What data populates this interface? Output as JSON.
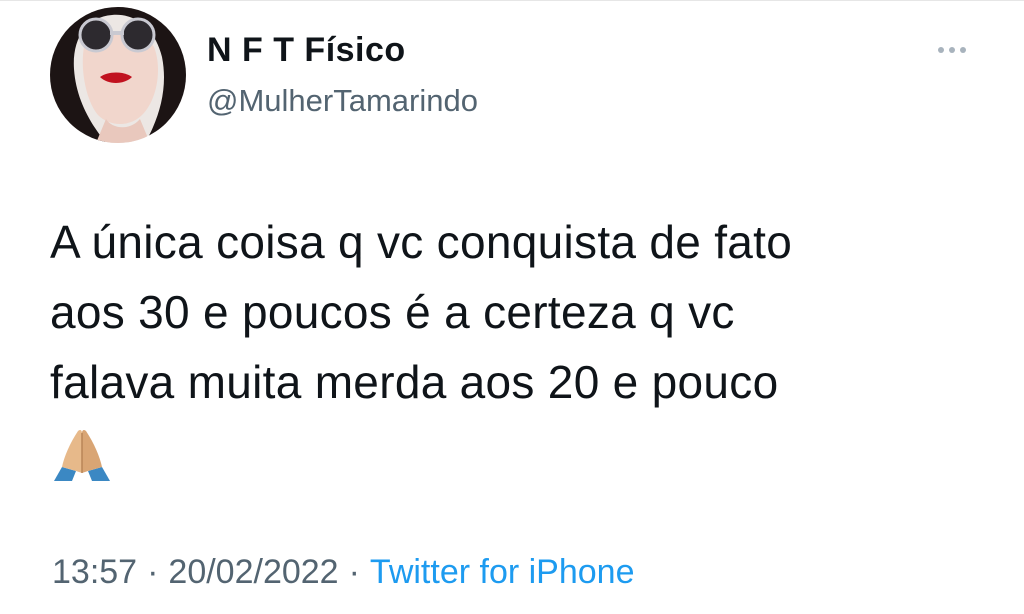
{
  "tweet": {
    "display_name": "N F T Físico",
    "handle": "@MulherTamarindo",
    "text": "A única coisa q vc conquista de fato\naos 30 e poucos é a certeza q vc\nfalava muita merda aos 20 e pouco",
    "emoji": "folded-hands",
    "time": "13:57",
    "separator": "·",
    "date": "20/02/2022",
    "source": "Twitter for iPhone"
  },
  "colors": {
    "text": "#0f1419",
    "secondary": "#536471",
    "link": "#1d9bf0"
  }
}
